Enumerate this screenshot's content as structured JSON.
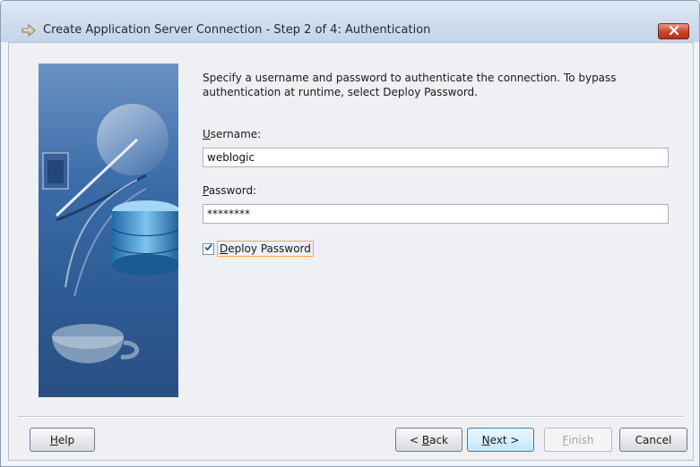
{
  "window": {
    "title": "Create Application Server Connection - Step 2 of 4: Authentication"
  },
  "content": {
    "instructions": "Specify a username and password to authenticate the connection. To bypass authentication at runtime, select Deploy Password.",
    "username": {
      "mnemonic": "U",
      "label_rest": "sername:",
      "value": "weblogic"
    },
    "password": {
      "mnemonic": "P",
      "label_rest": "assword:",
      "value": "********"
    },
    "deploy_password": {
      "mnemonic": "D",
      "label_rest": "eploy Password",
      "checked": true
    }
  },
  "buttons": {
    "help": {
      "mnemonic": "H",
      "rest": "elp"
    },
    "back": {
      "prefix": "< ",
      "mnemonic": "B",
      "rest": "ack"
    },
    "next": {
      "mnemonic": "N",
      "rest": "ext >"
    },
    "finish": {
      "mnemonic": "F",
      "rest": "inish",
      "disabled": true
    },
    "cancel": {
      "label": "Cancel"
    }
  },
  "icons": {
    "app": "connection-arrow-icon",
    "close": "close-icon",
    "check": "checkmark-icon",
    "illustration": "server-database-illustration"
  },
  "colors": {
    "titlebar": "#cfdcec",
    "close_button": "#c9432a",
    "focus_outline": "#f2a65a",
    "illustration_blue": "#3c6da9"
  }
}
